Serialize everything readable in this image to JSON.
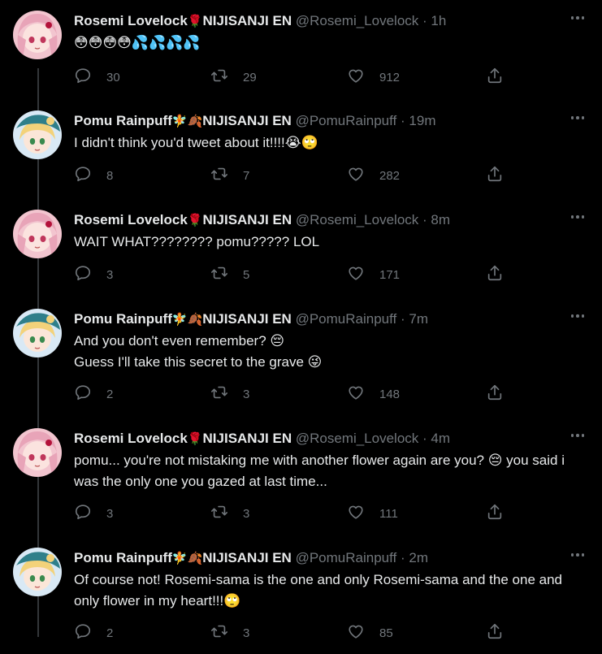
{
  "tweets": [
    {
      "name": "Rosemi Lovelock",
      "name_emoji": "🌹",
      "org": "NIJISANJI EN",
      "handle": "@Rosemi_Lovelock",
      "time": "1h",
      "text": "😳😳😳😳💦💦💦💦",
      "reply": "30",
      "retweet": "29",
      "like": "912",
      "avatar": "rosemi"
    },
    {
      "name": "Pomu Rainpuff",
      "name_emoji": "🧚🍂",
      "org": "NIJISANJI EN",
      "handle": "@PomuRainpuff",
      "time": "19m",
      "text": "I didn't think you'd tweet about it!!!!😭🙄",
      "reply": "8",
      "retweet": "7",
      "like": "282",
      "avatar": "pomu"
    },
    {
      "name": "Rosemi Lovelock",
      "name_emoji": "🌹",
      "org": "NIJISANJI EN",
      "handle": "@Rosemi_Lovelock",
      "time": "8m",
      "text": "WAIT WHAT???????? pomu????? LOL",
      "reply": "3",
      "retweet": "5",
      "like": "171",
      "avatar": "rosemi"
    },
    {
      "name": "Pomu Rainpuff",
      "name_emoji": "🧚🍂",
      "org": "NIJISANJI EN",
      "handle": "@PomuRainpuff",
      "time": "7m",
      "text": "And you don't even remember? 😔\nGuess I'll take this secret to the grave 😜",
      "reply": "2",
      "retweet": "3",
      "like": "148",
      "avatar": "pomu"
    },
    {
      "name": "Rosemi Lovelock",
      "name_emoji": "🌹",
      "org": "NIJISANJI EN",
      "handle": "@Rosemi_Lovelock",
      "time": "4m",
      "text": "pomu... you're not mistaking me with another flower again are you? 😔 you said i was the only one you gazed at last time...",
      "reply": "3",
      "retweet": "3",
      "like": "111",
      "avatar": "rosemi"
    },
    {
      "name": "Pomu Rainpuff",
      "name_emoji": "🧚🍂",
      "org": "NIJISANJI EN",
      "handle": "@PomuRainpuff",
      "time": "2m",
      "text": "Of course not! Rosemi-sama is the one and only Rosemi-sama and the one and only flower in my heart!!!🙄",
      "reply": "2",
      "retweet": "3",
      "like": "85",
      "avatar": "pomu"
    }
  ],
  "separator": "·",
  "icons": {
    "reply": "reply-icon",
    "retweet": "retweet-icon",
    "like": "heart-icon",
    "share": "share-icon",
    "more": "more-icon"
  },
  "colors": {
    "background": "#000000",
    "text": "#e7e9ea",
    "muted": "#71767b",
    "thread_line": "#333639"
  }
}
